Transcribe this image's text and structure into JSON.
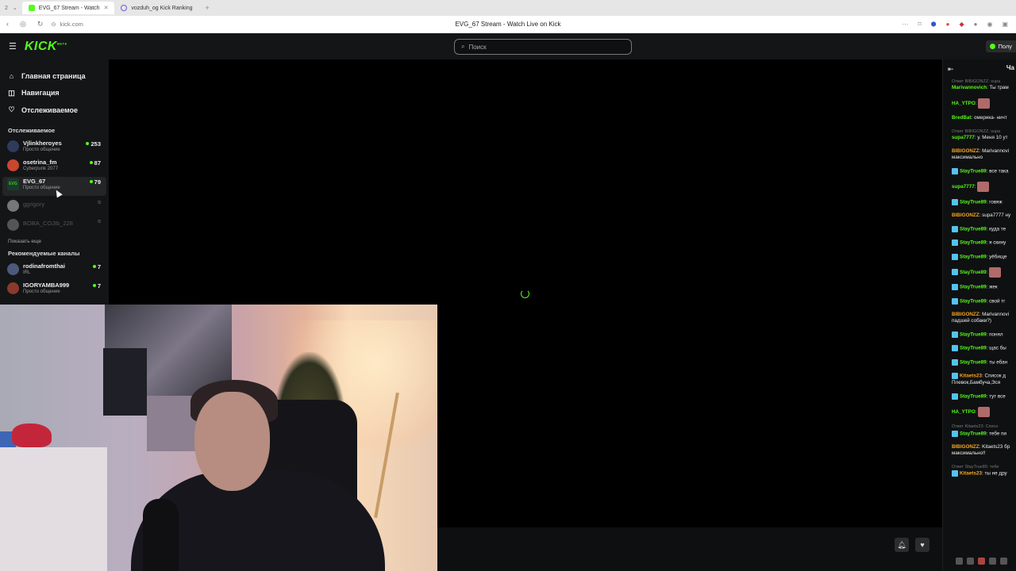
{
  "browser": {
    "tab_count": "2",
    "tabs": [
      {
        "label": "EVG_67 Stream - Watch",
        "active": true
      },
      {
        "label": "vozduh_og Kick Ranking",
        "active": false
      }
    ],
    "new_tab_icon": "+",
    "address": "kick.com",
    "page_title": "EVG_67 Stream - Watch Live on Kick"
  },
  "topnav": {
    "logo": "KICK",
    "logo_badge": "BETA",
    "search_placeholder": "Поиск",
    "login_label": "Полу"
  },
  "sidebar": {
    "nav": [
      {
        "label": "Главная страница",
        "icon": "home-icon"
      },
      {
        "label": "Навигация",
        "icon": "compass-icon"
      },
      {
        "label": "Отслеживаемое",
        "icon": "heart-icon"
      }
    ],
    "followed_title": "Отслеживаемое",
    "followed": [
      {
        "name": "Vjlinkheroyes",
        "category": "Просто общение",
        "viewers": "253",
        "live": true
      },
      {
        "name": "osetrina_fm",
        "category": "Cyberpunk 2077",
        "viewers": "87",
        "live": true
      },
      {
        "name": "EVG_67",
        "category": "Просто общение",
        "viewers": "79",
        "live": true
      },
      {
        "name": "ggrigory",
        "category": "",
        "viewers": "",
        "live": false
      },
      {
        "name": "BOBA_COJIb_228",
        "category": "",
        "viewers": "",
        "live": false
      }
    ],
    "show_more": "Показать еще",
    "recommended_title": "Рекомендуемые каналы",
    "recommended": [
      {
        "name": "rodinafromthai",
        "category": "IRL",
        "viewers": "7"
      },
      {
        "name": "IGORYAMBA999",
        "category": "Просто общение",
        "viewers": "7"
      }
    ]
  },
  "chat": {
    "title": "Ча",
    "messages": [
      {
        "reply": "Ответ BIBIGONZZ: supa",
        "user": "Marivannovich",
        "color": "#53fc18",
        "text": "Ты трам"
      },
      {
        "user": "HA_YTPO",
        "color": "#53fc18",
        "text": "",
        "emote": true
      },
      {
        "user": "BredBat",
        "color": "#53fc18",
        "text": "омерика- ничт"
      },
      {
        "reply": "Ответ BIBIGONZZ: supa",
        "user": "supa7777",
        "color": "#53fc18",
        "text": "у. Меня 10 ут"
      },
      {
        "user": "BIBIGONZZ",
        "color": "#f5a623",
        "text": "Marivannovi",
        "text2": "максимально"
      },
      {
        "user": "StayTrue89",
        "color": "#53fc18",
        "text": "все така",
        "badge": true
      },
      {
        "user": "supa7777",
        "color": "#53fc18",
        "text": "",
        "emote": true
      },
      {
        "user": "StayTrue89",
        "color": "#53fc18",
        "text": "говяж",
        "badge": true
      },
      {
        "user": "BIBIGONZZ",
        "color": "#f5a623",
        "text": "supa7777 ну"
      },
      {
        "user": "StayTrue89",
        "color": "#53fc18",
        "text": "куда те",
        "badge": true
      },
      {
        "user": "StayTrue89",
        "color": "#53fc18",
        "text": "я скину",
        "badge": true
      },
      {
        "user": "StayTrue89",
        "color": "#53fc18",
        "text": "уёбище",
        "badge": true
      },
      {
        "user": "StayTrue89",
        "color": "#53fc18",
        "text": "",
        "badge": true,
        "emote": true
      },
      {
        "user": "StayTrue89",
        "color": "#53fc18",
        "text": "жек",
        "badge": true
      },
      {
        "user": "StayTrue89",
        "color": "#53fc18",
        "text": "свой тг",
        "badge": true
      },
      {
        "user": "BIBIGONZZ",
        "color": "#f5a623",
        "text": "Marivannovi",
        "text2": "падшей собаки?)"
      },
      {
        "user": "StayTrue89",
        "color": "#53fc18",
        "text": "понял",
        "badge": true
      },
      {
        "user": "StayTrue89",
        "color": "#53fc18",
        "text": "щас бы",
        "badge": true
      },
      {
        "user": "StayTrue89",
        "color": "#53fc18",
        "text": "ты ебан",
        "badge": true
      },
      {
        "user": "Kitaets23",
        "color": "#f5a623",
        "text": "Список д",
        "text2": "Плевок,Бамбуча,Эся",
        "badge": true
      },
      {
        "user": "StayTrue89",
        "color": "#53fc18",
        "text": "тут все",
        "badge": true
      },
      {
        "user": "HA_YTPO",
        "color": "#53fc18",
        "text": "",
        "emote": true
      },
      {
        "reply": "Ответ Kitaets23: Списо",
        "user": "StayTrue89",
        "color": "#53fc18",
        "text": "тебе пи",
        "badge": true
      },
      {
        "user": "BIBIGONZZ",
        "color": "#f5a623",
        "text": "Kitaets23 бр",
        "text2": "максимально!!"
      },
      {
        "reply": "Ответ StayTrue89: тебе",
        "user": "Kitaets23",
        "color": "#f5a623",
        "text": "ты не дру",
        "badge": true
      }
    ]
  }
}
